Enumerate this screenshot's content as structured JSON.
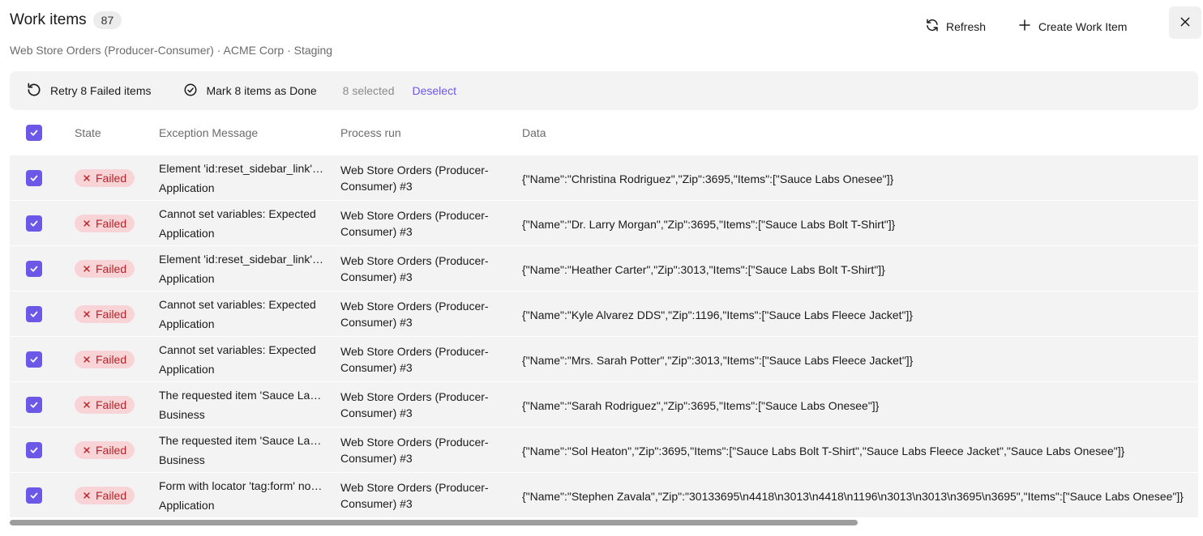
{
  "header": {
    "title": "Work items",
    "count": "87",
    "subtitle": "Web Store Orders (Producer-Consumer) · ACME Corp · Staging",
    "refresh_label": "Refresh",
    "create_label": "Create Work Item"
  },
  "toolbar": {
    "retry_label": "Retry 8 Failed items",
    "done_label": "Mark 8 items as Done",
    "selected_text": "8 selected",
    "deselect_label": "Deselect"
  },
  "columns": {
    "state": "State",
    "exception": "Exception Message",
    "run": "Process run",
    "data": "Data"
  },
  "rows": [
    {
      "state": "Failed",
      "exception": "Element 'id:reset_sidebar_link' not found",
      "exception_type": "Application",
      "run": "Web Store Orders (Producer-Consumer) #3",
      "data": "{\"Name\":\"Christina Rodriguez\",\"Zip\":3695,\"Items\":[\"Sauce Labs Onesee\"]}"
    },
    {
      "state": "Failed",
      "exception": "Cannot set variables: Expected",
      "exception_type": "Application",
      "run": "Web Store Orders (Producer-Consumer) #3",
      "data": "{\"Name\":\"Dr. Larry Morgan\",\"Zip\":3695,\"Items\":[\"Sauce Labs Bolt T-Shirt\"]}"
    },
    {
      "state": "Failed",
      "exception": "Element 'id:reset_sidebar_link' not found",
      "exception_type": "Application",
      "run": "Web Store Orders (Producer-Consumer) #3",
      "data": "{\"Name\":\"Heather Carter\",\"Zip\":3013,\"Items\":[\"Sauce Labs Bolt T-Shirt\"]}"
    },
    {
      "state": "Failed",
      "exception": "Cannot set variables: Expected",
      "exception_type": "Application",
      "run": "Web Store Orders (Producer-Consumer) #3",
      "data": "{\"Name\":\"Kyle Alvarez DDS\",\"Zip\":1196,\"Items\":[\"Sauce Labs Fleece Jacket\"]}"
    },
    {
      "state": "Failed",
      "exception": "Cannot set variables: Expected",
      "exception_type": "Application",
      "run": "Web Store Orders (Producer-Consumer) #3",
      "data": "{\"Name\":\"Mrs. Sarah Potter\",\"Zip\":3013,\"Items\":[\"Sauce Labs Fleece Jacket\"]}"
    },
    {
      "state": "Failed",
      "exception": "The requested item 'Sauce Labs Onesee'",
      "exception_type": "Business",
      "run": "Web Store Orders (Producer-Consumer) #3",
      "data": "{\"Name\":\"Sarah Rodriguez\",\"Zip\":3695,\"Items\":[\"Sauce Labs Onesee\"]}"
    },
    {
      "state": "Failed",
      "exception": "The requested item 'Sauce Labs Onesee'",
      "exception_type": "Business",
      "run": "Web Store Orders (Producer-Consumer) #3",
      "data": "{\"Name\":\"Sol Heaton\",\"Zip\":3695,\"Items\":[\"Sauce Labs Bolt T-Shirt\",\"Sauce Labs Fleece Jacket\",\"Sauce Labs Onesee\"]}"
    },
    {
      "state": "Failed",
      "exception": "Form with locator 'tag:form' not found",
      "exception_type": "Application",
      "run": "Web Store Orders (Producer-Consumer) #3",
      "data": "{\"Name\":\"Stephen Zavala\",\"Zip\":\"30133695\\n4418\\n3013\\n4418\\n1196\\n3013\\n3013\\n3695\\n3695\",\"Items\":[\"Sauce Labs Onesee\"]}"
    }
  ],
  "colors": {
    "accent": "#6b57e8",
    "failed_bg": "#f9d4d6",
    "failed_text": "#b4232a",
    "row_bg": "#f3f3f3"
  },
  "icons": {
    "refresh": "refresh-icon",
    "create": "plus-icon",
    "close": "close-icon",
    "retry": "retry-icon",
    "done": "check-circle-icon",
    "failed": "x-icon",
    "checkbox": "checkbox-checked-icon"
  }
}
